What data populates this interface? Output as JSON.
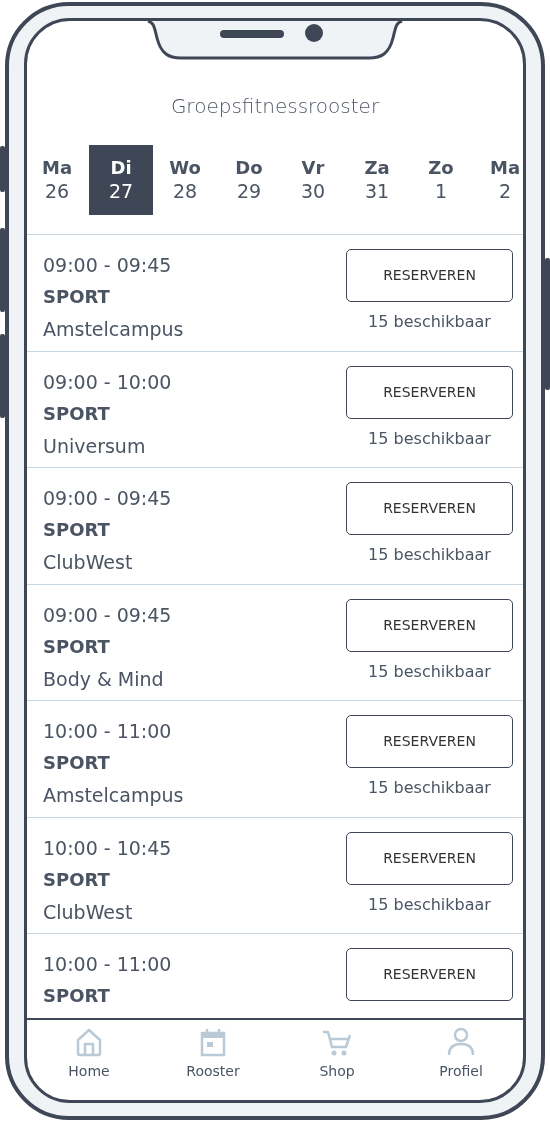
{
  "title": "Groepsfitnessrooster",
  "days": [
    {
      "weekday": "Ma",
      "date": "26",
      "selected": false
    },
    {
      "weekday": "Di",
      "date": "27",
      "selected": true
    },
    {
      "weekday": "Wo",
      "date": "28",
      "selected": false
    },
    {
      "weekday": "Do",
      "date": "29",
      "selected": false
    },
    {
      "weekday": "Vr",
      "date": "30",
      "selected": false
    },
    {
      "weekday": "Za",
      "date": "31",
      "selected": false
    },
    {
      "weekday": "Zo",
      "date": "1",
      "selected": false
    },
    {
      "weekday": "Ma",
      "date": "2",
      "selected": false
    }
  ],
  "classes": [
    {
      "time": "09:00 - 09:45",
      "category": "SPORT",
      "location": "Amstelcampus",
      "button": "RESERVEREN",
      "availability": "15 beschikbaar"
    },
    {
      "time": "09:00 - 10:00",
      "category": "SPORT",
      "location": "Universum",
      "button": "RESERVEREN",
      "availability": "15 beschikbaar"
    },
    {
      "time": "09:00 - 09:45",
      "category": "SPORT",
      "location": "ClubWest",
      "button": "RESERVEREN",
      "availability": "15 beschikbaar"
    },
    {
      "time": "09:00 - 09:45",
      "category": "SPORT",
      "location": "Body & Mind",
      "button": "RESERVEREN",
      "availability": "15 beschikbaar"
    },
    {
      "time": "10:00 - 11:00",
      "category": "SPORT",
      "location": "Amstelcampus",
      "button": "RESERVEREN",
      "availability": "15 beschikbaar"
    },
    {
      "time": "10:00 - 10:45",
      "category": "SPORT",
      "location": "ClubWest",
      "button": "RESERVEREN",
      "availability": "15 beschikbaar"
    },
    {
      "time": "10:00 - 11:00",
      "category": "SPORT",
      "button": "RESERVEREN"
    }
  ],
  "tab_bar": [
    {
      "kind": "home",
      "label": "Home",
      "selected": false
    },
    {
      "kind": "calendar",
      "label": "Rooster",
      "selected": false
    },
    {
      "kind": "cart",
      "label": "Shop",
      "selected": false
    },
    {
      "kind": "person",
      "label": "Profiel",
      "selected": false
    }
  ]
}
